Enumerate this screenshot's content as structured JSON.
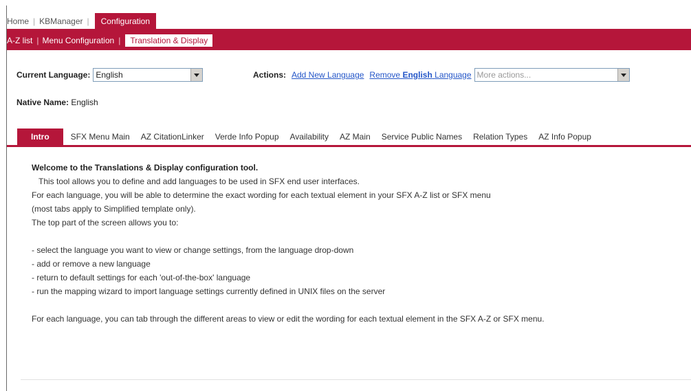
{
  "topnav": {
    "items": [
      "Home",
      "KBManager"
    ],
    "active": "Configuration"
  },
  "subnav": {
    "items": [
      "A-Z list",
      "Menu Configuration"
    ],
    "active": "Translation & Display"
  },
  "language": {
    "label": "Current Language:",
    "selected": "English",
    "actions_label": "Actions:",
    "add_link": "Add New Language",
    "remove_prefix": "Remove",
    "remove_lang": "English",
    "remove_suffix": "Language",
    "more_actions": "More actions...",
    "native_label": "Native Name:",
    "native_value": "English"
  },
  "tabs": [
    "Intro",
    "SFX Menu Main",
    "AZ CitationLinker",
    "Verde Info Popup",
    "Availability",
    "AZ Main",
    "Service Public Names",
    "Relation Types",
    "AZ Info Popup"
  ],
  "content": {
    "welcome": "Welcome to the Translations & Display configuration tool.",
    "lines": [
      "This tool allows you to define and add languages to be used in SFX end user interfaces.",
      "For each language, you will be able to determine the exact wording for each textual element in your SFX A-Z list or SFX menu",
      "(most tabs apply to Simplified template only).",
      "The top part of the screen allows you to:"
    ],
    "bullets": [
      "- select the language you want to view or change settings, from the language drop-down",
      "- add or remove a new language",
      "- return to default settings for each 'out-of-the-box' language",
      "- run the mapping wizard to import language settings currently defined in UNIX files on the server"
    ],
    "footer": "For each language, you can tab through the different areas to view or edit the wording for each textual element in the SFX A-Z or SFX menu."
  },
  "colors": {
    "brand": "#b5163a",
    "link": "#2456c8"
  }
}
